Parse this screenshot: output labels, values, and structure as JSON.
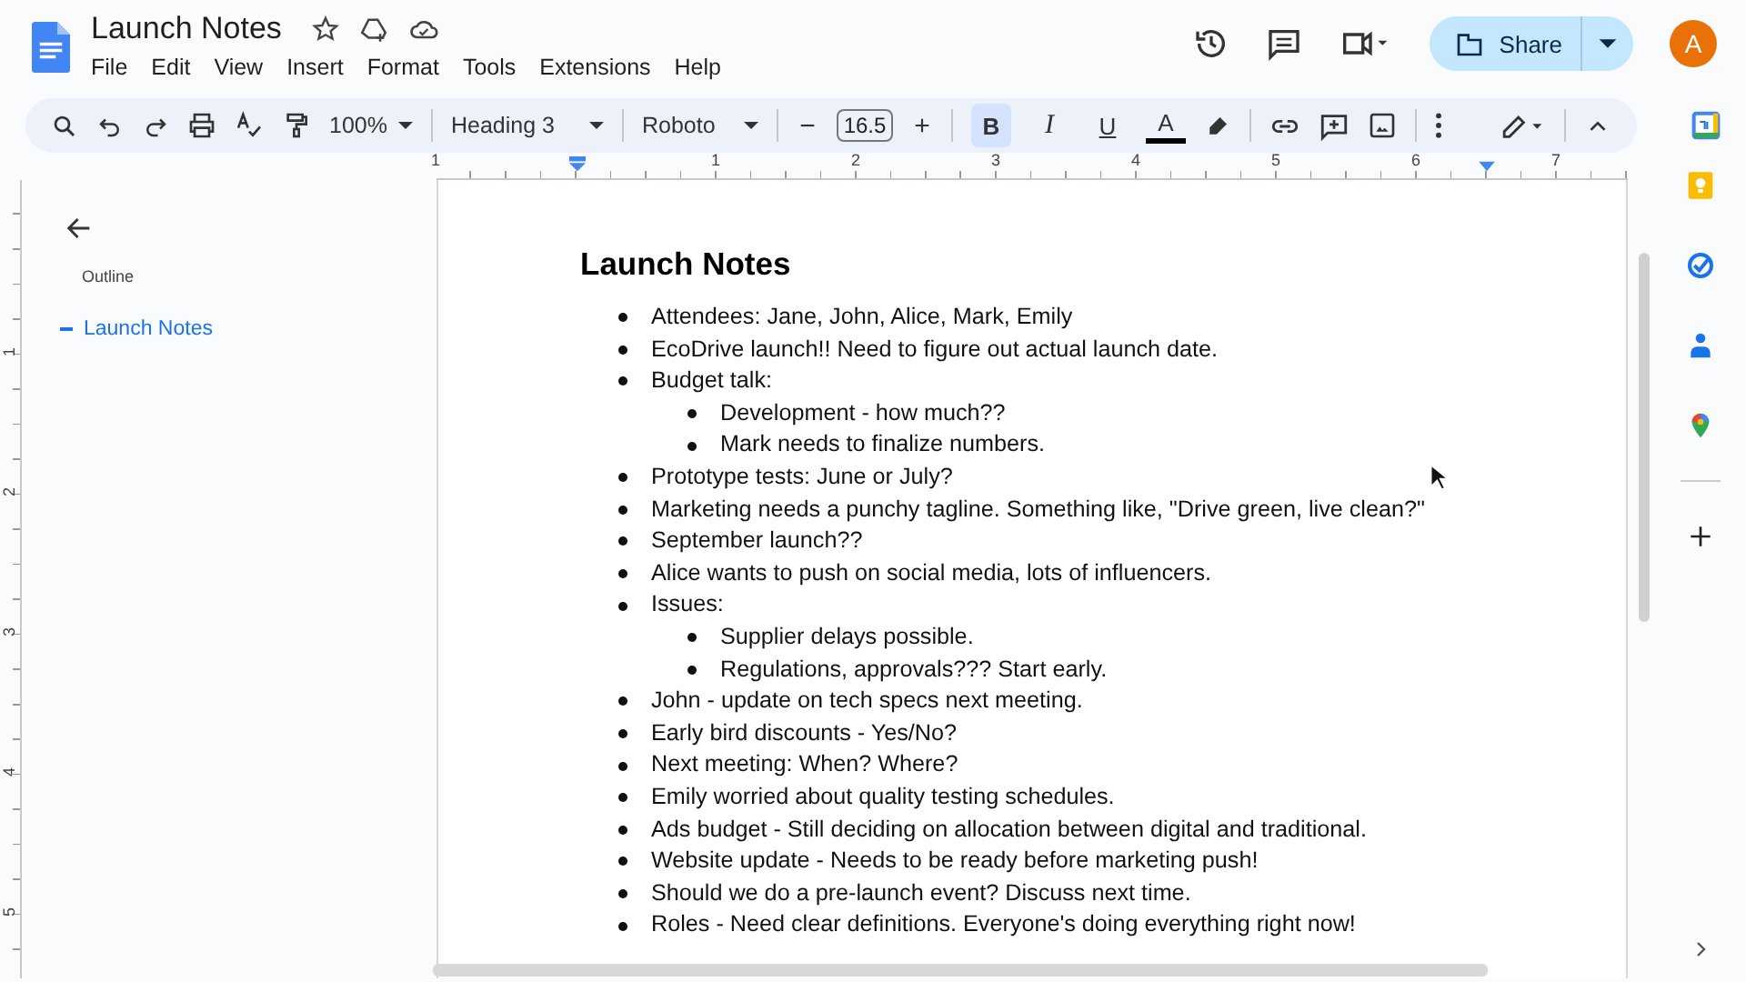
{
  "window": {
    "title": "Launch Notes"
  },
  "menu": [
    "File",
    "Edit",
    "View",
    "Insert",
    "Format",
    "Tools",
    "Extensions",
    "Help"
  ],
  "header": {
    "share_label": "Share",
    "avatar_letter": "A"
  },
  "toolbar": {
    "zoom": "100%",
    "style": "Heading 3",
    "font": "Roboto",
    "font_size": "16.5",
    "minus": "−",
    "plus": "+",
    "format_buttons": [
      {
        "kind": "bold",
        "label": "B",
        "selected": true
      },
      {
        "kind": "italic",
        "label": "I",
        "selected": false
      },
      {
        "kind": "underline",
        "label": "U",
        "selected": false
      },
      {
        "kind": "color",
        "label": "A",
        "selected": false
      }
    ]
  },
  "ruler": {
    "horizontal": [
      "1",
      "1",
      "2",
      "3",
      "4",
      "5",
      "6",
      "7"
    ],
    "vertical": [
      "1",
      "2",
      "3",
      "4",
      "5"
    ]
  },
  "outline": {
    "title": "Outline",
    "items": [
      {
        "label": "Launch Notes",
        "selected": true
      }
    ]
  },
  "document": {
    "heading": "Launch Notes",
    "bullets": [
      {
        "text": "Attendees: Jane, John, Alice, Mark, Emily"
      },
      {
        "text": "EcoDrive launch!! Need to figure out actual launch date."
      },
      {
        "text": "Budget talk:",
        "children": [
          {
            "text": "Development - how much??"
          },
          {
            "text": "Mark needs to finalize numbers."
          }
        ]
      },
      {
        "text": "Prototype tests: June or July?"
      },
      {
        "text": "Marketing needs a punchy tagline. Something like, \"Drive green, live clean?\""
      },
      {
        "text": "September launch??"
      },
      {
        "text": "Alice wants to push on social media, lots of influencers."
      },
      {
        "text": "Issues:",
        "children": [
          {
            "text": "Supplier delays possible."
          },
          {
            "text": "Regulations, approvals??? Start early."
          }
        ]
      },
      {
        "text": "John - update on tech specs next meeting."
      },
      {
        "text": "Early bird discounts - Yes/No?"
      },
      {
        "text": "Next meeting: When? Where?"
      },
      {
        "text": "Emily worried about quality testing schedules."
      },
      {
        "text": "Ads budget - Still deciding on allocation between digital and traditional."
      },
      {
        "text": "Website update - Needs to be ready before marketing push!"
      },
      {
        "text": "Should we do a pre-launch event? Discuss next time."
      },
      {
        "text": "Roles - Need clear definitions. Everyone's doing everything right now!"
      }
    ]
  }
}
